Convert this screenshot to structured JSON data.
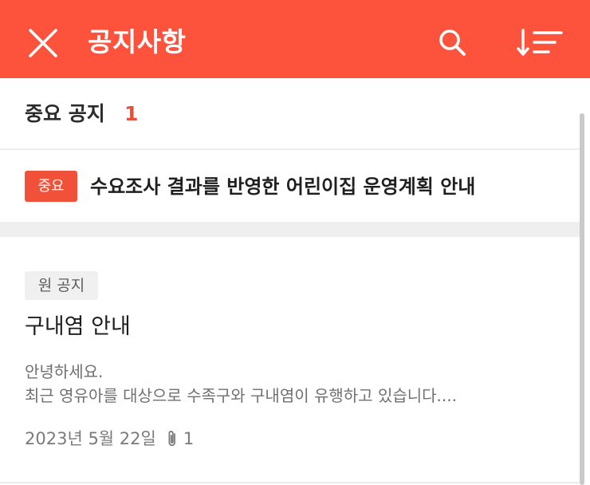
{
  "header": {
    "title": "공지사항",
    "close_icon": "close-icon",
    "search_icon": "search-icon",
    "sort_icon": "sort-icon",
    "accent_color": "#fd533c"
  },
  "important_section": {
    "title": "중요 공지",
    "count": "1",
    "items": [
      {
        "badge": "중요",
        "title": "수요조사 결과를 반영한 어린이집 운영계획 안내"
      }
    ]
  },
  "posts": [
    {
      "badge": "원 공지",
      "title": "구내염 안내",
      "preview_lines": [
        "안녕하세요.",
        "최근 영유아를 대상으로 수족구와 구내염이 유행하고 있습니다...."
      ],
      "date": "2023년 5월 22일",
      "attachment_icon": "paperclip-icon",
      "attachment_count": "1"
    }
  ]
}
